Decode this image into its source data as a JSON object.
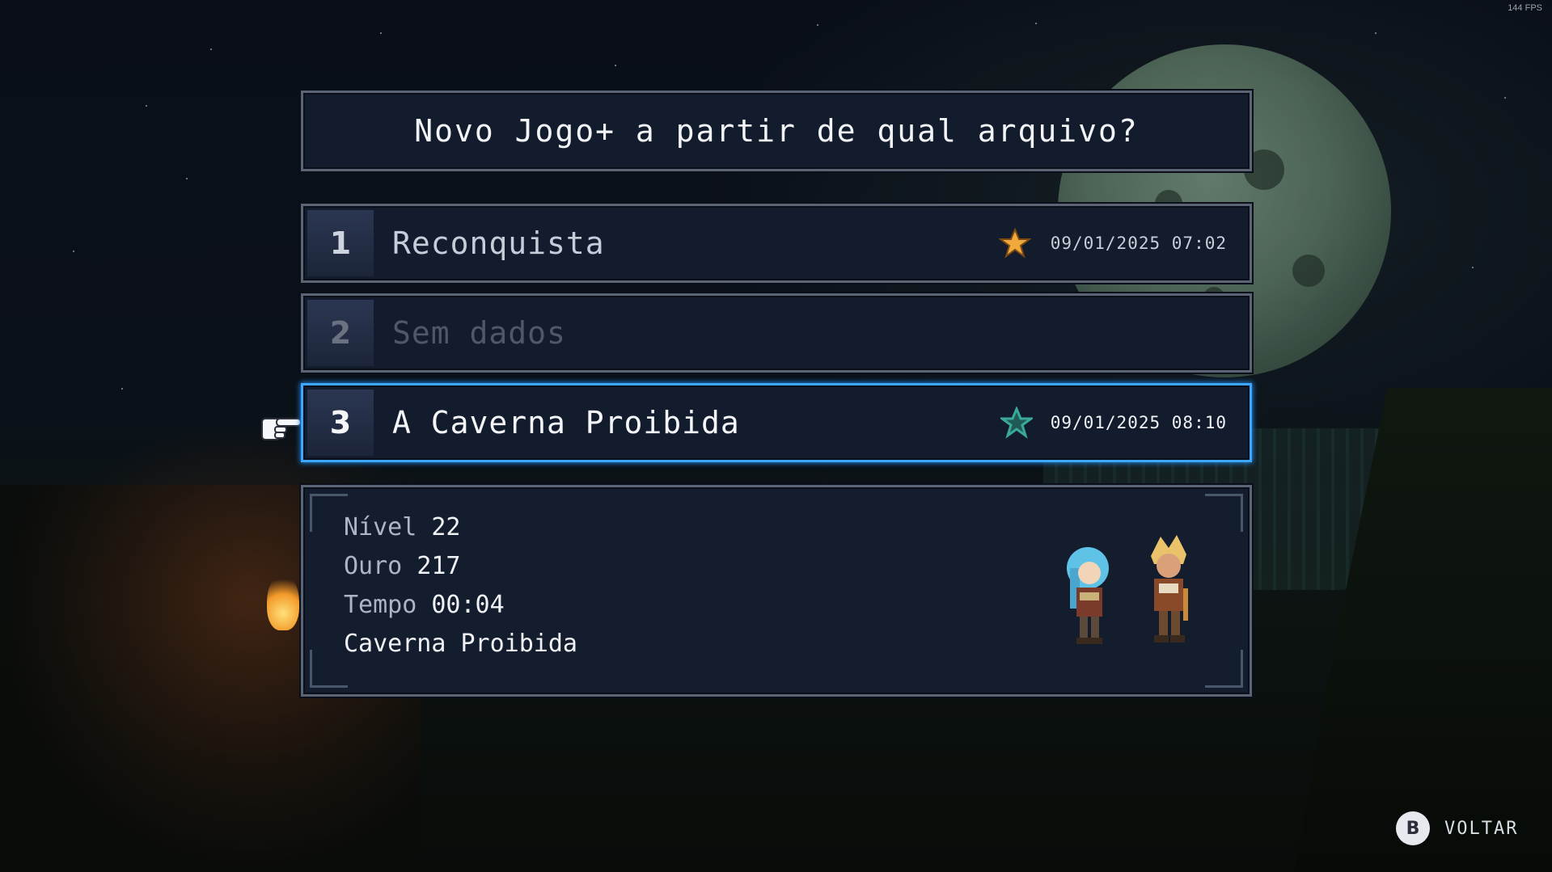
{
  "hud": {
    "fps": "144 FPS"
  },
  "dialog": {
    "title": "Novo Jogo+ a partir de qual arquivo?"
  },
  "slots": [
    {
      "number": "1",
      "name": "Reconquista",
      "date": "09/01/2025 07:02",
      "star_color": "#f2a93b",
      "selected": false
    },
    {
      "number": "2",
      "name": "Sem dados",
      "date": "",
      "star_color": "",
      "selected": false
    },
    {
      "number": "3",
      "name": "A Caverna Proibida",
      "date": "09/01/2025 08:10",
      "star_color": "#3aa89a",
      "selected": true
    }
  ],
  "details": {
    "level_label": "Nível",
    "level_value": "22",
    "gold_label": "Ouro",
    "gold_value": "217",
    "time_label": "Tempo",
    "time_value": "00:04",
    "location": "Caverna Proibida"
  },
  "controls": {
    "back_button": "B",
    "back_label": "VOLTAR"
  },
  "colors": {
    "selection_border": "#3da7ff",
    "panel_bg": "#131c2d"
  }
}
